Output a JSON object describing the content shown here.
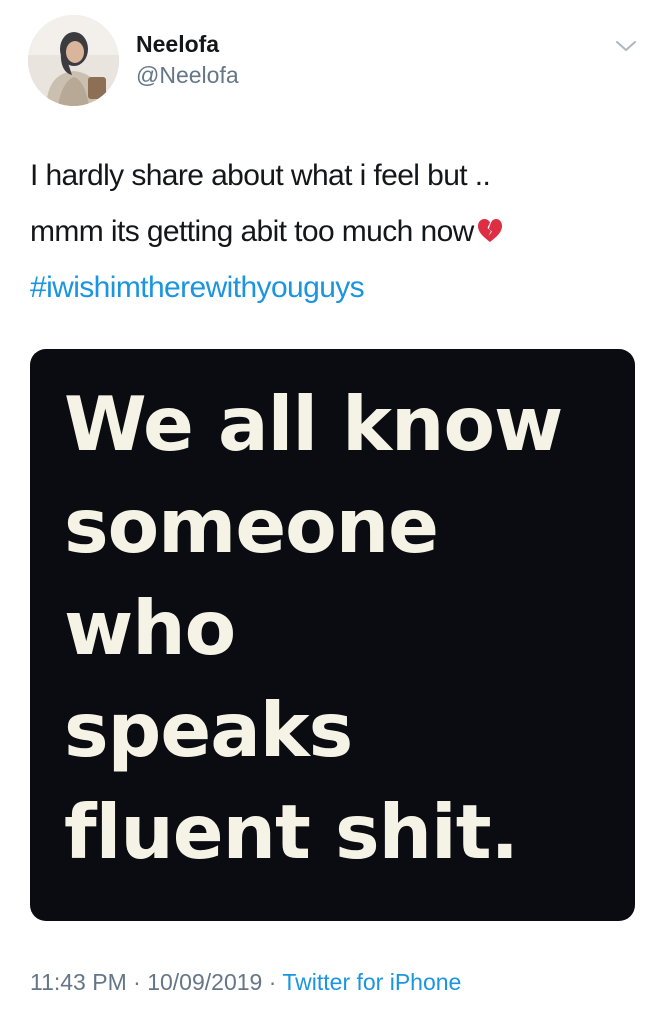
{
  "user": {
    "display_name": "Neelofa",
    "handle": "@Neelofa",
    "avatar_icon": "profile-photo"
  },
  "tweet": {
    "text_lines": [
      "I hardly share about what i feel but ..",
      "mmm its getting abit too much now"
    ],
    "emoji": "broken-heart-icon",
    "hashtag": "#iwishimtherewithyouguys"
  },
  "media": {
    "meme_lines": [
      "We all know",
      "someone",
      "who",
      "speaks",
      "fluent shit."
    ],
    "background_color": "#0b0b12",
    "text_color": "#f5f3e6"
  },
  "meta": {
    "time": "11:43 PM",
    "separator": "·",
    "date": "10/09/2019",
    "source": "Twitter for iPhone"
  },
  "colors": {
    "link": "#1b95e0",
    "secondary_text": "#657786",
    "primary_text": "#14171a"
  }
}
